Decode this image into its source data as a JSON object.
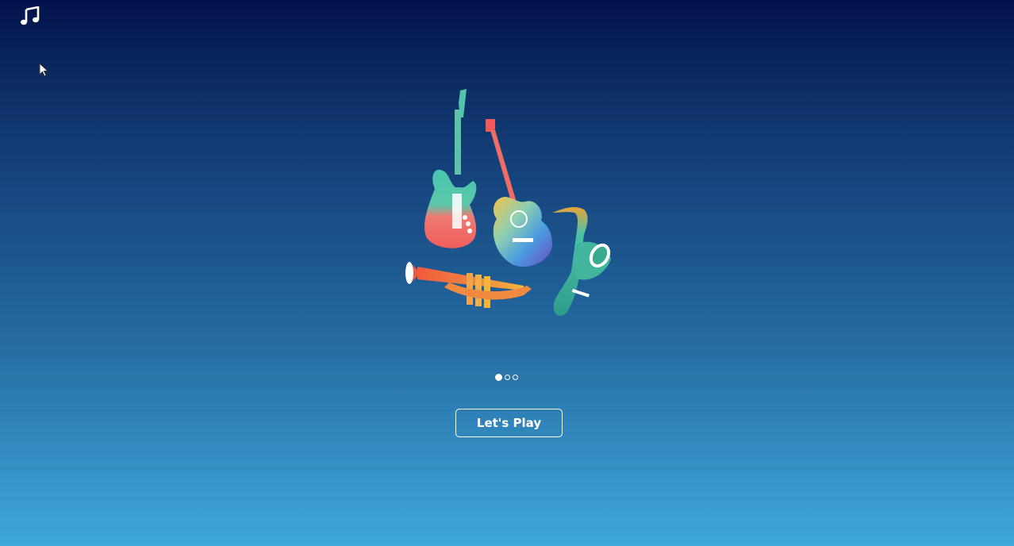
{
  "header": {
    "music_icon": "music-note-icon"
  },
  "illustration": {
    "instruments": [
      "electric-guitar",
      "acoustic-guitar",
      "trumpet",
      "saxophone"
    ]
  },
  "carousel": {
    "pages": 3,
    "active_index": 0
  },
  "cta": {
    "label": "Let's Play"
  },
  "colors": {
    "bg_top": "#03124a",
    "bg_bottom": "#3fa8db",
    "foreground": "#ffffff"
  }
}
